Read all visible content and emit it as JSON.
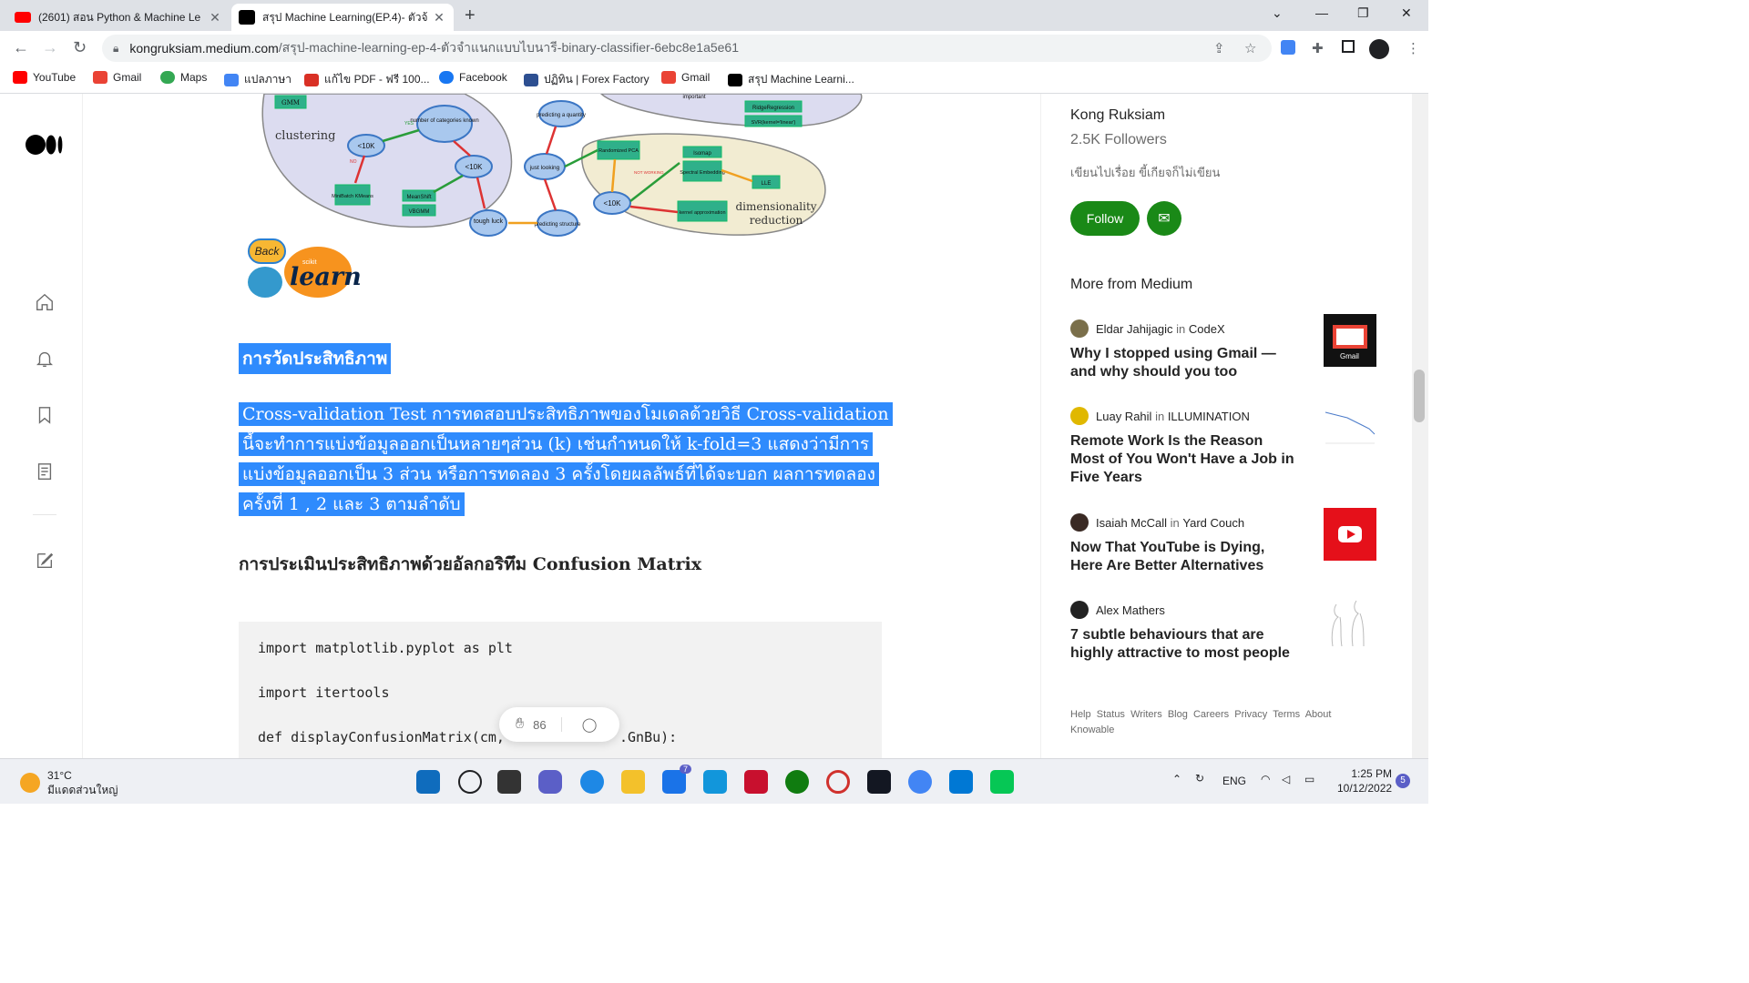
{
  "browser": {
    "tabs": [
      {
        "title": "(2601) สอน Python & Machine Le",
        "close": "✕"
      },
      {
        "title": "สรุป Machine Learning(EP.4)- ตัวจ้",
        "close": "✕"
      }
    ],
    "new_tab": "+",
    "window_controls": [
      "⌄",
      "—",
      "❐",
      "✕"
    ],
    "url_host": "kongruksiam.medium.com",
    "url_path": "/สรุป-machine-learning-ep-4-ตัวจำแนกแบบไบนารี-binary-classifier-6ebc8e1a5e61"
  },
  "bookmarks": [
    {
      "label": "YouTube",
      "color": "#ff0000"
    },
    {
      "label": "Gmail",
      "color": "#ea4335"
    },
    {
      "label": "Maps",
      "color": "#34a853"
    },
    {
      "label": "แปลภาษา",
      "color": "#4285f4"
    },
    {
      "label": "แก้ไข PDF - ฟรี 100...",
      "color": "#d93025"
    },
    {
      "label": "Facebook",
      "color": "#1877f2"
    },
    {
      "label": "ปฏิทิน | Forex Factory",
      "color": "#2d4f91"
    },
    {
      "label": "Gmail",
      "color": "#ea4335"
    },
    {
      "label": "สรุป Machine Learni...",
      "color": "#000000"
    }
  ],
  "article": {
    "diagram_labels": {
      "clustering": "clustering",
      "dimensionality": "dimensionality",
      "reduction": "reduction",
      "number_of_categories": "number of categories known",
      "lt10k_a": "<10K",
      "lt10k_b": "<10K",
      "lt10k_c": "<10K",
      "looking": "just looking",
      "tough_luck": "tough luck",
      "structure": "predicting structure",
      "quantity": "predicting a quantity",
      "gmm": "GMM",
      "minibatch": "MiniBatch KMeans",
      "meanshift": "MeanShift",
      "vbgmm": "VBGMM",
      "randomized_pca": "Randomized PCA",
      "isomap": "Isomap",
      "spectral": "Spectral Embedding",
      "lle": "LLE",
      "kernel": "kernel approximation",
      "ridge": "RidgeRegression",
      "svr": "SVR(kernel='linear')",
      "important": "important",
      "yes": "YES",
      "no": "NO",
      "not_working": "NOT WORKING"
    },
    "back_label": "Back",
    "logo_small": "scikit",
    "logo_text": "learn",
    "heading1": "การวัดประสิทธิภาพ",
    "para_lines": [
      "Cross-validation Test การทดสอบประสิทธิภาพของโมเดลด้วยวิธี Cross-validation",
      "นี้จะทำการแบ่งข้อมูลออกเป็นหลายๆส่วน (k) เช่นกำหนดให้ k-fold=3 แสดงว่ามีการ",
      "แบ่งข้อมูลออกเป็น 3 ส่วน หรือการทดลอง 3 ครั้งโดยผลลัพธ์ที่ได้จะบอก ผลการทดลอง",
      "ครั้งที่ 1 , 2 และ 3 ตามลำดับ"
    ],
    "heading2": "การประเมินประสิทธิภาพด้วยอัลกอริทึม Confusion Matrix",
    "code_lines": [
      "import matplotlib.pyplot as plt",
      "import itertools",
      "def displayConfusionMatrix(cm,",
      ".GnBu):"
    ],
    "clap_count": "86"
  },
  "sidebar": {
    "author_name": "Kong Ruksiam",
    "followers": "2.5K Followers",
    "bio": "เขียนไปเรื่อย ขี้เกียจก็ไม่เขียน",
    "follow_label": "Follow",
    "subscribe_icon": "✉",
    "more_from": "More from Medium",
    "stories": [
      {
        "author": "Eldar Jahijagic",
        "in": "in",
        "pub": "CodeX",
        "title": "Why I stopped using Gmail — and why should you too",
        "thumb_label": "Gmail"
      },
      {
        "author": "Luay Rahil",
        "in": "in",
        "pub": "ILLUMINATION",
        "title": "Remote Work Is the Reason Most of You Won't Have a Job in Five Years",
        "thumb_label": ""
      },
      {
        "author": "Isaiah McCall",
        "in": "in",
        "pub": "Yard Couch",
        "title": "Now That YouTube is Dying, Here Are Better Alternatives",
        "thumb_label": ""
      },
      {
        "author": "Alex Mathers",
        "in": "",
        "pub": "",
        "title": "7 subtle behaviours that are highly attractive to most people",
        "thumb_label": ""
      }
    ],
    "footer_links": [
      "Help",
      "Status",
      "Writers",
      "Blog",
      "Careers",
      "Privacy",
      "Terms",
      "About",
      "Knowable"
    ]
  },
  "taskbar": {
    "temp": "31°C",
    "weather": "มีแดดส่วนใหญ่",
    "lang": "ENG",
    "time": "1:25 PM",
    "date": "10/12/2022",
    "notif_count": "5",
    "mail_badge": "7"
  }
}
